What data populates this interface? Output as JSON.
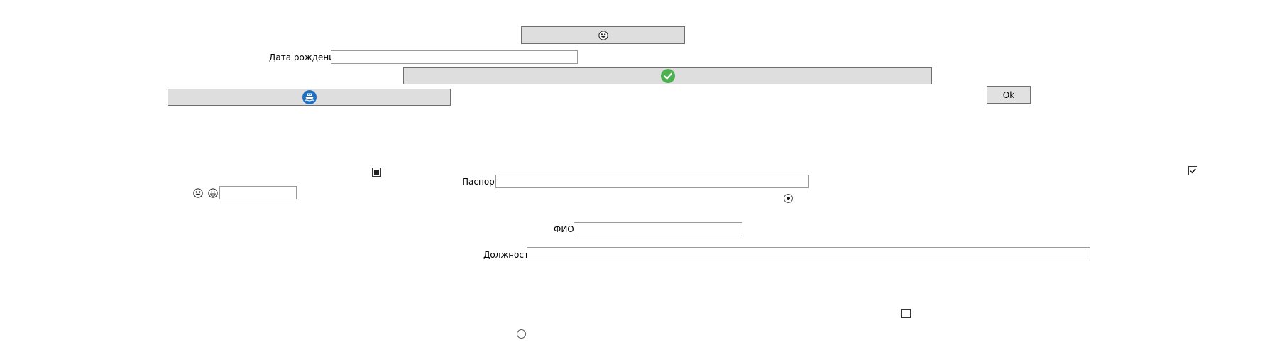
{
  "form": {
    "birth_date_label": "Дата рождения",
    "birth_date_value": "",
    "passport_label": "Паспорт",
    "passport_value": "",
    "fio_label": "ФИО",
    "fio_value": "",
    "position_label": "Должность",
    "position_value": "",
    "small_field_value": "",
    "ok_label": "Ok"
  },
  "icons": {
    "top_button": "grinning-face-icon",
    "wide_button": "green-check-circle-icon",
    "left_button": "blue-ship-icon",
    "small_faces": [
      "grinning-face-icon",
      "smiling-face-icon"
    ]
  },
  "controls": {
    "checkbox_filled_state": "indeterminate",
    "checkbox_right_checked": true,
    "checkbox_bottom_checked": false,
    "radio_right_selected": true,
    "radio_bottom_selected": false
  },
  "colors": {
    "button_bg": "#dedede",
    "check_green": "#4caf50",
    "ship_blue": "#1e6fc0"
  }
}
